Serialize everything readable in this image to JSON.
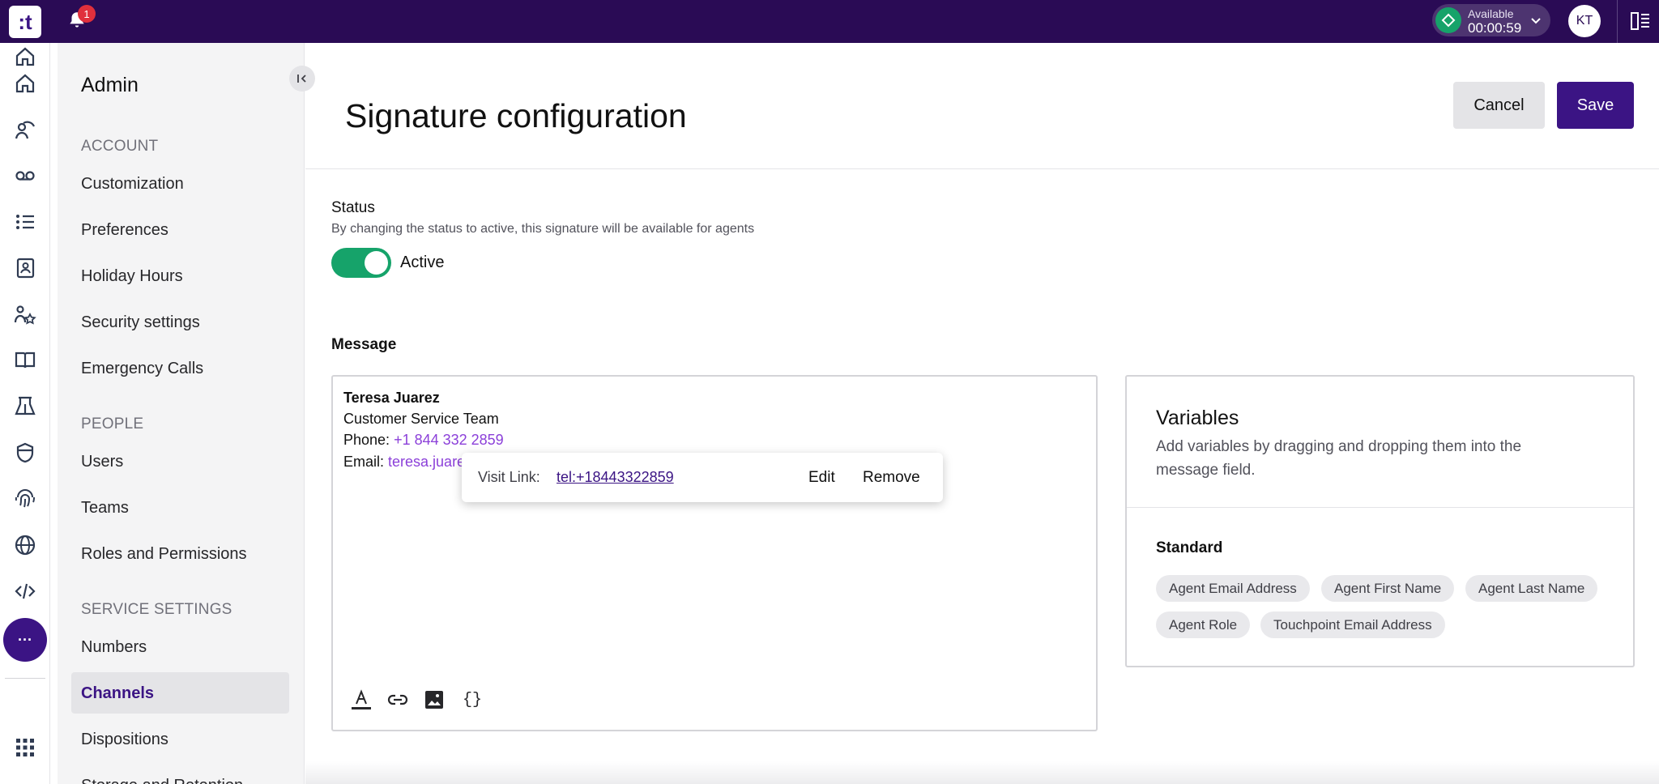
{
  "topbar": {
    "logo_text": ":t",
    "notification_count": "1",
    "status": {
      "label": "Available",
      "timer": "00:00:59",
      "color": "#16a36a"
    },
    "avatar_initials": "KT",
    "brand_color": "#2a0b55"
  },
  "rail": {
    "icons": [
      "home-icon",
      "agent-icon",
      "voicemail-icon",
      "list-icon",
      "contacts-icon",
      "team-star-icon",
      "book-icon",
      "flow-icon",
      "shield-icon",
      "fingerprint-icon",
      "globe-icon",
      "code-icon",
      "more-icon",
      "apps-grid-icon"
    ],
    "more_label": "···"
  },
  "admin": {
    "title": "Admin",
    "sections": [
      {
        "label": "ACCOUNT",
        "items": [
          "Customization",
          "Preferences",
          "Holiday Hours",
          "Security settings",
          "Emergency Calls"
        ]
      },
      {
        "label": "PEOPLE",
        "items": [
          "Users",
          "Teams",
          "Roles and Permissions"
        ]
      },
      {
        "label": "SERVICE SETTINGS",
        "items": [
          "Numbers",
          "Channels",
          "Dispositions",
          "Storage and Retention"
        ]
      }
    ],
    "active_item": "Channels"
  },
  "header": {
    "title": "Signature configuration",
    "cancel_label": "Cancel",
    "save_label": "Save",
    "accent": "#3b1484"
  },
  "status": {
    "heading": "Status",
    "description": "By changing the status to active, this signature will be available for agents",
    "toggle_on": true,
    "toggle_label": "Active"
  },
  "message": {
    "heading": "Message",
    "lines": {
      "name": "Teresa Juarez",
      "team": "Customer Service Team",
      "phone_label": "Phone: ",
      "phone_value": "+1 844 332 2859",
      "email_label": "Email: ",
      "email_value": "teresa.juarez"
    },
    "popover": {
      "visit_label": "Visit Link:",
      "link": "tel:+18443322859",
      "edit_label": "Edit",
      "remove_label": "Remove"
    },
    "toolbar": [
      "text-color-icon",
      "link-icon",
      "image-icon",
      "variables-braces-icon"
    ],
    "braces_glyph": "{}"
  },
  "variables": {
    "title": "Variables",
    "description": "Add variables by dragging and dropping them into the message field.",
    "group_label": "Standard",
    "chips": [
      "Agent Email Address",
      "Agent First Name",
      "Agent Last Name",
      "Agent Role",
      "Touchpoint Email Address"
    ]
  }
}
